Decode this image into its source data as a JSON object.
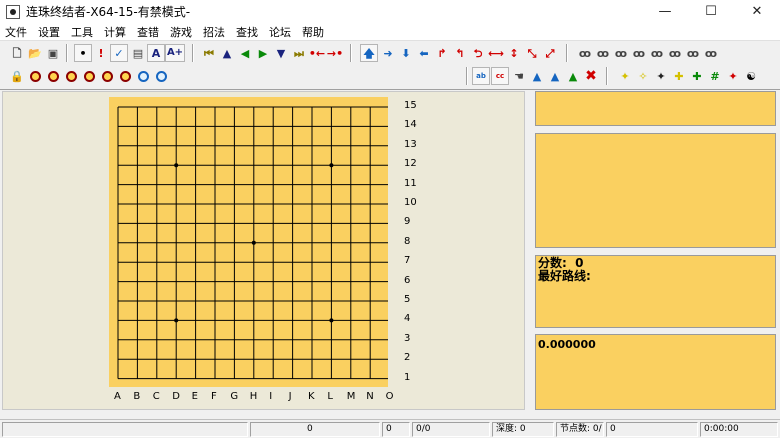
{
  "window": {
    "title": "连珠终结者-X64-15-有禁模式-",
    "minimize_label": "—",
    "maximize_label": "☐",
    "close_label": "✕"
  },
  "menu": [
    "文件",
    "设置",
    "工具",
    "计算",
    "查错",
    "游戏",
    "招法",
    "查找",
    "论坛",
    "帮助"
  ],
  "toolbar": {
    "font_decrease": "A",
    "font_increase": "A+",
    "icons": [
      "new-file",
      "open-folder",
      "save-disk",
      "stone-mark",
      "exclamation",
      "checkmark",
      "image-frame",
      "font-decrease",
      "font-increase",
      "first-move",
      "up-triangle",
      "left-triangle",
      "right-triangle",
      "down-triangle",
      "last-move",
      "move-left-dots",
      "move-right-dots",
      "arrow-up",
      "arrow-right",
      "arrow-down",
      "arrow-left",
      "turn-right",
      "turn-left",
      "u-turn",
      "left-right",
      "up-down",
      "diagonal-in",
      "diagonal-out",
      "search-foot-1",
      "search-foot-2",
      "search-foot-3",
      "search-foot-4",
      "search-foot-5",
      "search-foot-6",
      "search-foot-7",
      "search-foot-8",
      "lock",
      "zoom-1",
      "zoom-2",
      "zoom-3",
      "zoom-4",
      "zoom-5",
      "zoom-6",
      "zoom-in",
      "zoom-out",
      "abc-label",
      "cc-label",
      "hand",
      "tree-1",
      "tree-2",
      "tree-3",
      "red-x",
      "star-1",
      "star-2",
      "star-3",
      "star-4",
      "star-5",
      "grid-hash",
      "red-star",
      "yin-yang"
    ]
  },
  "board": {
    "size": 15,
    "columns": [
      "A",
      "B",
      "C",
      "D",
      "E",
      "F",
      "G",
      "H",
      "I",
      "J",
      "K",
      "L",
      "M",
      "N",
      "O"
    ],
    "rows": [
      "15",
      "14",
      "13",
      "12",
      "11",
      "10",
      "9",
      "8",
      "7",
      "6",
      "5",
      "4",
      "3",
      "2",
      "1"
    ],
    "star_points": [
      [
        "D",
        12
      ],
      [
        "L",
        12
      ],
      [
        "H",
        8
      ],
      [
        "D",
        4
      ],
      [
        "L",
        4
      ]
    ]
  },
  "panels": {
    "score_label": "分数:",
    "score_value": "0",
    "best_line_label": "最好路线:",
    "eval_value": "0.000000"
  },
  "status": {
    "cell2": "0",
    "cell3": "0",
    "cell4": "0/0",
    "depth": "深度: 0",
    "nodes": "节点数: 0/",
    "cell7": "0",
    "time": "0:00:00"
  },
  "colors": {
    "board": "#fad060",
    "panel": "#fad060",
    "pane_bg": "#ece9d8"
  }
}
